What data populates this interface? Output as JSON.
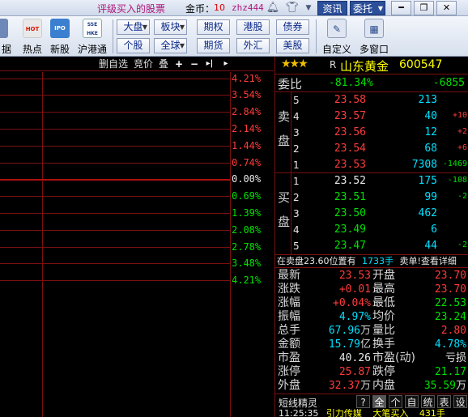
{
  "topbar": {
    "ad_text": "评级买入的股票",
    "coins_label": "金币：",
    "coins_value": "10",
    "username": "zhz444",
    "zixun": "资讯",
    "weituo": "委托",
    "min": "━",
    "restore": "❐",
    "close": "✕"
  },
  "toolbar": {
    "tools": [
      {
        "label": "据",
        "icon": "data-icon"
      },
      {
        "label": "热点",
        "icon": "hot-icon",
        "badge": "HOT"
      },
      {
        "label": "新股",
        "icon": "ipo-icon",
        "badge": "IPO"
      },
      {
        "label": "沪港通",
        "icon": "sse-hkex-icon",
        "badge": "SSE HKE"
      }
    ],
    "markets": [
      "大盘",
      "板块",
      "期权",
      "港股",
      "债券",
      "个股",
      "全球",
      "期货",
      "外汇",
      "美股"
    ],
    "right_tools": [
      {
        "label": "自定义",
        "icon": "custom-icon"
      },
      {
        "label": "多窗口",
        "icon": "multi-window-icon"
      }
    ]
  },
  "chart": {
    "header": {
      "delete_self": "删自选",
      "bid": "竞价",
      "overlay": "叠",
      "plus": "+",
      "minus": "−",
      "next": "▸|",
      "right": "▸"
    },
    "pct_labels": [
      {
        "text": "4.21%",
        "color": "#ff3b3b"
      },
      {
        "text": "3.54%",
        "color": "#ff3b3b"
      },
      {
        "text": "2.84%",
        "color": "#ff3b3b"
      },
      {
        "text": "2.14%",
        "color": "#ff3b3b"
      },
      {
        "text": "1.44%",
        "color": "#ff3b3b"
      },
      {
        "text": "0.74%",
        "color": "#ff3b3b"
      },
      {
        "text": "0.00%",
        "color": "#e8e8e8"
      },
      {
        "text": "0.69%",
        "color": "#00e000"
      },
      {
        "text": "1.39%",
        "color": "#00e000"
      },
      {
        "text": "2.08%",
        "color": "#00e000"
      },
      {
        "text": "2.78%",
        "color": "#00e000"
      },
      {
        "text": "3.48%",
        "color": "#00e000"
      },
      {
        "text": "4.21%",
        "color": "#00e000"
      }
    ]
  },
  "quote": {
    "stars": "★★★",
    "r_mark": "R",
    "name": "山东黄金",
    "code": "600547",
    "ratio_label": "委比",
    "ratio_value": "-81.34%",
    "ratio_diff": "-6855",
    "sell_label": [
      "卖",
      "盘"
    ],
    "buy_label": [
      "买",
      "盘"
    ],
    "sell": [
      {
        "level": "5",
        "price": "23.58",
        "vol": "213",
        "chg": "",
        "price_color": "red",
        "chg_color": "red"
      },
      {
        "level": "4",
        "price": "23.57",
        "vol": "40",
        "chg": "+10",
        "price_color": "red",
        "chg_color": "red"
      },
      {
        "level": "3",
        "price": "23.56",
        "vol": "12",
        "chg": "+2",
        "price_color": "red",
        "chg_color": "red"
      },
      {
        "level": "2",
        "price": "23.54",
        "vol": "68",
        "chg": "+6",
        "price_color": "red",
        "chg_color": "red"
      },
      {
        "level": "1",
        "price": "23.53",
        "vol": "7308",
        "chg": "-1469",
        "price_color": "red",
        "chg_color": "green"
      }
    ],
    "buy": [
      {
        "level": "1",
        "price": "23.52",
        "vol": "175",
        "chg": "-108",
        "price_color": "white",
        "chg_color": "green"
      },
      {
        "level": "2",
        "price": "23.51",
        "vol": "99",
        "chg": "-2",
        "price_color": "green",
        "chg_color": "green"
      },
      {
        "level": "3",
        "price": "23.50",
        "vol": "462",
        "chg": "",
        "price_color": "green",
        "chg_color": "green"
      },
      {
        "level": "4",
        "price": "23.49",
        "vol": "6",
        "chg": "",
        "price_color": "green",
        "chg_color": "green"
      },
      {
        "level": "5",
        "price": "23.47",
        "vol": "44",
        "chg": "-2",
        "price_color": "green",
        "chg_color": "green"
      }
    ],
    "notice": {
      "a": "在卖盘23.60位置有",
      "b": "1733手",
      "c": "卖单!查看详细"
    },
    "stats": [
      {
        "l1": "最新",
        "v1": "23.53",
        "c1": "red",
        "u1": "",
        "l2": "开盘",
        "v2": "23.70",
        "c2": "red",
        "u2": ""
      },
      {
        "l1": "涨跌",
        "v1": "+0.01",
        "c1": "red",
        "u1": "",
        "l2": "最高",
        "v2": "23.70",
        "c2": "red",
        "u2": ""
      },
      {
        "l1": "涨幅",
        "v1": "+0.04%",
        "c1": "red",
        "u1": "",
        "l2": "最低",
        "v2": "22.53",
        "c2": "green",
        "u2": ""
      },
      {
        "l1": "振幅",
        "v1": "4.97%",
        "c1": "cyan",
        "u1": "",
        "l2": "均价",
        "v2": "23.24",
        "c2": "green",
        "u2": ""
      },
      {
        "l1": "总手",
        "v1": "67.96",
        "c1": "cyan",
        "u1": "万",
        "l2": "量比",
        "v2": "2.80",
        "c2": "red",
        "u2": ""
      },
      {
        "l1": "金额",
        "v1": "15.79",
        "c1": "cyan",
        "u1": "亿",
        "l2": "换手",
        "v2": "4.78%",
        "c2": "cyan",
        "u2": ""
      },
      {
        "l1": "市盈",
        "v1": "40.26",
        "c1": "white",
        "u1": "",
        "l2": "市盈(动)",
        "v2": "亏损",
        "c2": "white",
        "u2": ""
      },
      {
        "l1": "涨停",
        "v1": "25.87",
        "c1": "red",
        "u1": "",
        "l2": "跌停",
        "v2": "21.17",
        "c2": "green",
        "u2": ""
      },
      {
        "l1": "外盘",
        "v1": "32.37",
        "c1": "red",
        "u1": "万",
        "l2": "内盘",
        "v2": "35.59",
        "c2": "green",
        "u2": "万"
      }
    ],
    "tabs_title": "短线精灵",
    "tabs": [
      "?",
      "全",
      "个",
      "自",
      "统",
      "表",
      "设"
    ],
    "active_tab": "全",
    "news": {
      "time": "11:25:35",
      "name": "引力传媒",
      "event": "大笔买入",
      "vol": "431手"
    }
  }
}
